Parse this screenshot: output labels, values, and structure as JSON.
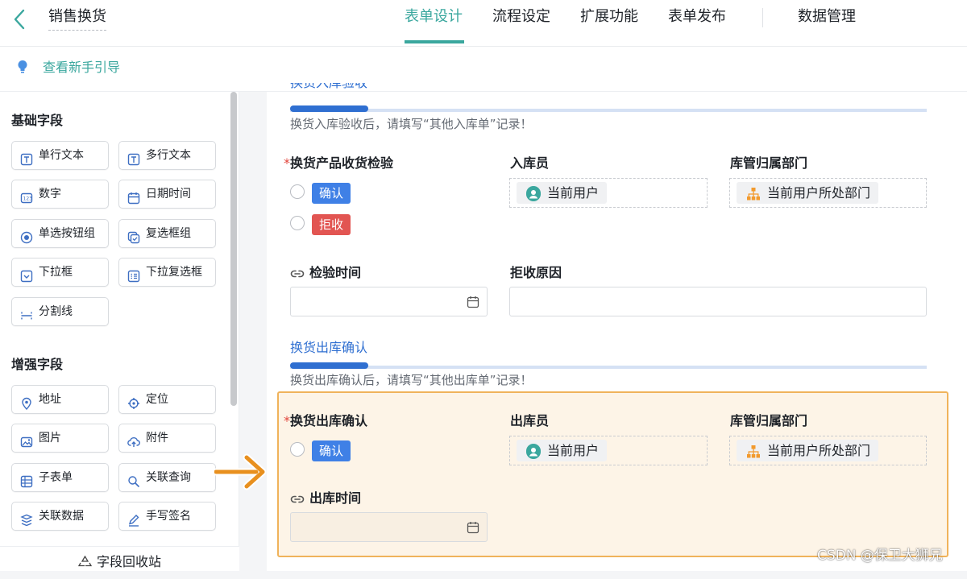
{
  "header": {
    "back_icon": "chevron-left-icon",
    "title": "销售换货",
    "tabs": [
      "表单设计",
      "流程设定",
      "扩展功能",
      "表单发布",
      "数据管理"
    ],
    "active_tab": "表单设计",
    "accent": "#3aa79e"
  },
  "guide": {
    "icon": "lightbulb-icon",
    "text": "查看新手引导"
  },
  "sidebar": {
    "basic_title": "基础字段",
    "basic_fields": [
      "单行文本",
      "多行文本",
      "数字",
      "日期时间",
      "单选按钮组",
      "复选框组",
      "下拉框",
      "下拉复选框",
      "分割线"
    ],
    "enhanced_title": "增强字段",
    "enhanced_fields": [
      "地址",
      "定位",
      "图片",
      "附件",
      "子表单",
      "关联查询",
      "关联数据",
      "手写签名"
    ],
    "recycle_label": "字段回收站"
  },
  "form": {
    "section1": {
      "title": "换货入库验收",
      "desc": "换货入库验收后，请填写“其他入库单”记录！",
      "field_inspection": {
        "required_mark": "*",
        "label": "换货产品收货检验",
        "options": [
          "确认",
          "拒收"
        ]
      },
      "field_receiver": {
        "label": "入库员",
        "value": "当前用户"
      },
      "field_dept": {
        "label": "库管归属部门",
        "value": "当前用户所处部门"
      },
      "field_inspect_time": {
        "label": "检验时间"
      },
      "field_reject_reason": {
        "label": "拒收原因"
      }
    },
    "section2": {
      "title": "换货出库确认",
      "desc": "换货出库确认后，请填写“其他出库单”记录！",
      "field_confirm": {
        "required_mark": "*",
        "label": "换货出库确认",
        "options": [
          "确认"
        ]
      },
      "field_shipper": {
        "label": "出库员",
        "value": "当前用户"
      },
      "field_dept": {
        "label": "库管归属部门",
        "value": "当前用户所处部门"
      },
      "field_out_time": {
        "label": "出库时间"
      }
    },
    "colors": {
      "section_blue": "#2f6fd1",
      "confirm_tag": "#3f80e6",
      "reject_tag": "#e25552",
      "highlight_border": "#f0b35b",
      "highlight_bg": "#fdf4e7"
    }
  },
  "watermark": "CSDN @保卫大狮兄"
}
